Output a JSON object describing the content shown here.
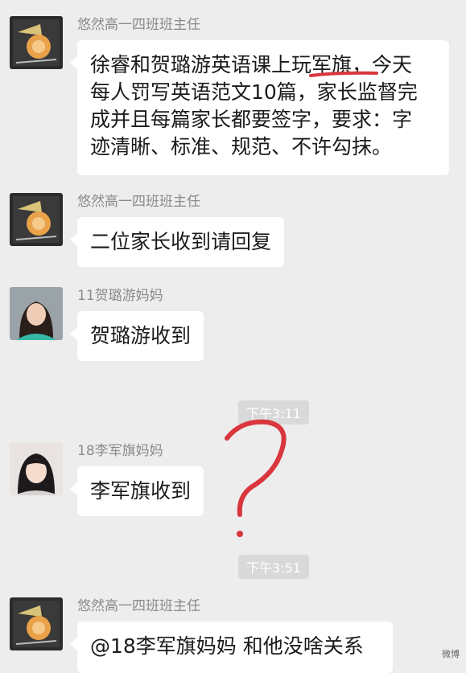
{
  "messages": [
    {
      "sender": "悠然高一四班班主任",
      "lines": [
        "徐睿和贺璐游英语课上玩军旗，今天",
        "每人罚写英语范文10篇，家长监督完",
        "成并且每篇家长都要签字，要求：字",
        "迹清晰、标准、规范、不许勾抹。"
      ],
      "avatar_icon": "teacher-avatar-icon"
    },
    {
      "sender": "悠然高一四班班主任",
      "lines": [
        "二位家长收到请回复"
      ],
      "avatar_icon": "teacher-avatar-icon"
    },
    {
      "sender": "11贺璐游妈妈",
      "lines": [
        "贺璐游收到"
      ],
      "avatar_icon": "parent-avatar-icon"
    },
    {
      "sender": "18李军旗妈妈",
      "lines": [
        "李军旗收到"
      ],
      "avatar_icon": "parent-avatar-icon"
    },
    {
      "sender": "悠然高一四班班主任",
      "lines": [
        "@18李军旗妈妈 和他没啥关系"
      ],
      "avatar_icon": "teacher-avatar-icon"
    }
  ],
  "timestamps": [
    "下午3:11",
    "下午3:51"
  ],
  "annotations": {
    "underline_color": "#d9363e",
    "question_mark_color": "#d9363e"
  },
  "watermark": "微博"
}
